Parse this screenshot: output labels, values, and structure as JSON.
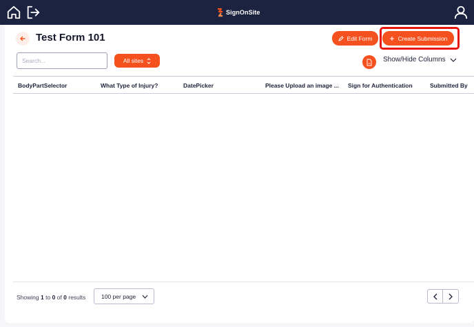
{
  "header": {
    "brand": "SignOnSite",
    "icons": {
      "home": "home-icon",
      "logout": "logout-icon",
      "profile": "user-icon",
      "logo": "signonsite-logo"
    }
  },
  "page": {
    "title": "Test Form 101",
    "back_icon": "arrow-left-icon"
  },
  "actions": {
    "edit_label": "Edit Form",
    "edit_icon": "pencil-icon",
    "create_label": "Create Submission",
    "create_icon": "plus-icon"
  },
  "filters": {
    "search_placeholder": "Search...",
    "sites_label": "All sites",
    "sites_icon": "updown-chevron-icon",
    "csv_icon": "csv-file-icon",
    "columns_label": "Show/Hide Columns",
    "columns_icon": "chevron-down-icon"
  },
  "table": {
    "columns": [
      "BodyPartSelector",
      "What Type of Injury?",
      "DatePicker",
      "Please Upload an image ...",
      "Sign for Authentication",
      "Submitted By"
    ],
    "rows": []
  },
  "pagination": {
    "showing": "Showing",
    "from": "1",
    "to_word": "to",
    "to": "0",
    "of_word": "of",
    "total": "0",
    "results_word": "results",
    "per_page": "100 per page"
  },
  "colors": {
    "topbar": "#1c2340",
    "accent": "#f4511e",
    "highlight": "#e8150c"
  }
}
